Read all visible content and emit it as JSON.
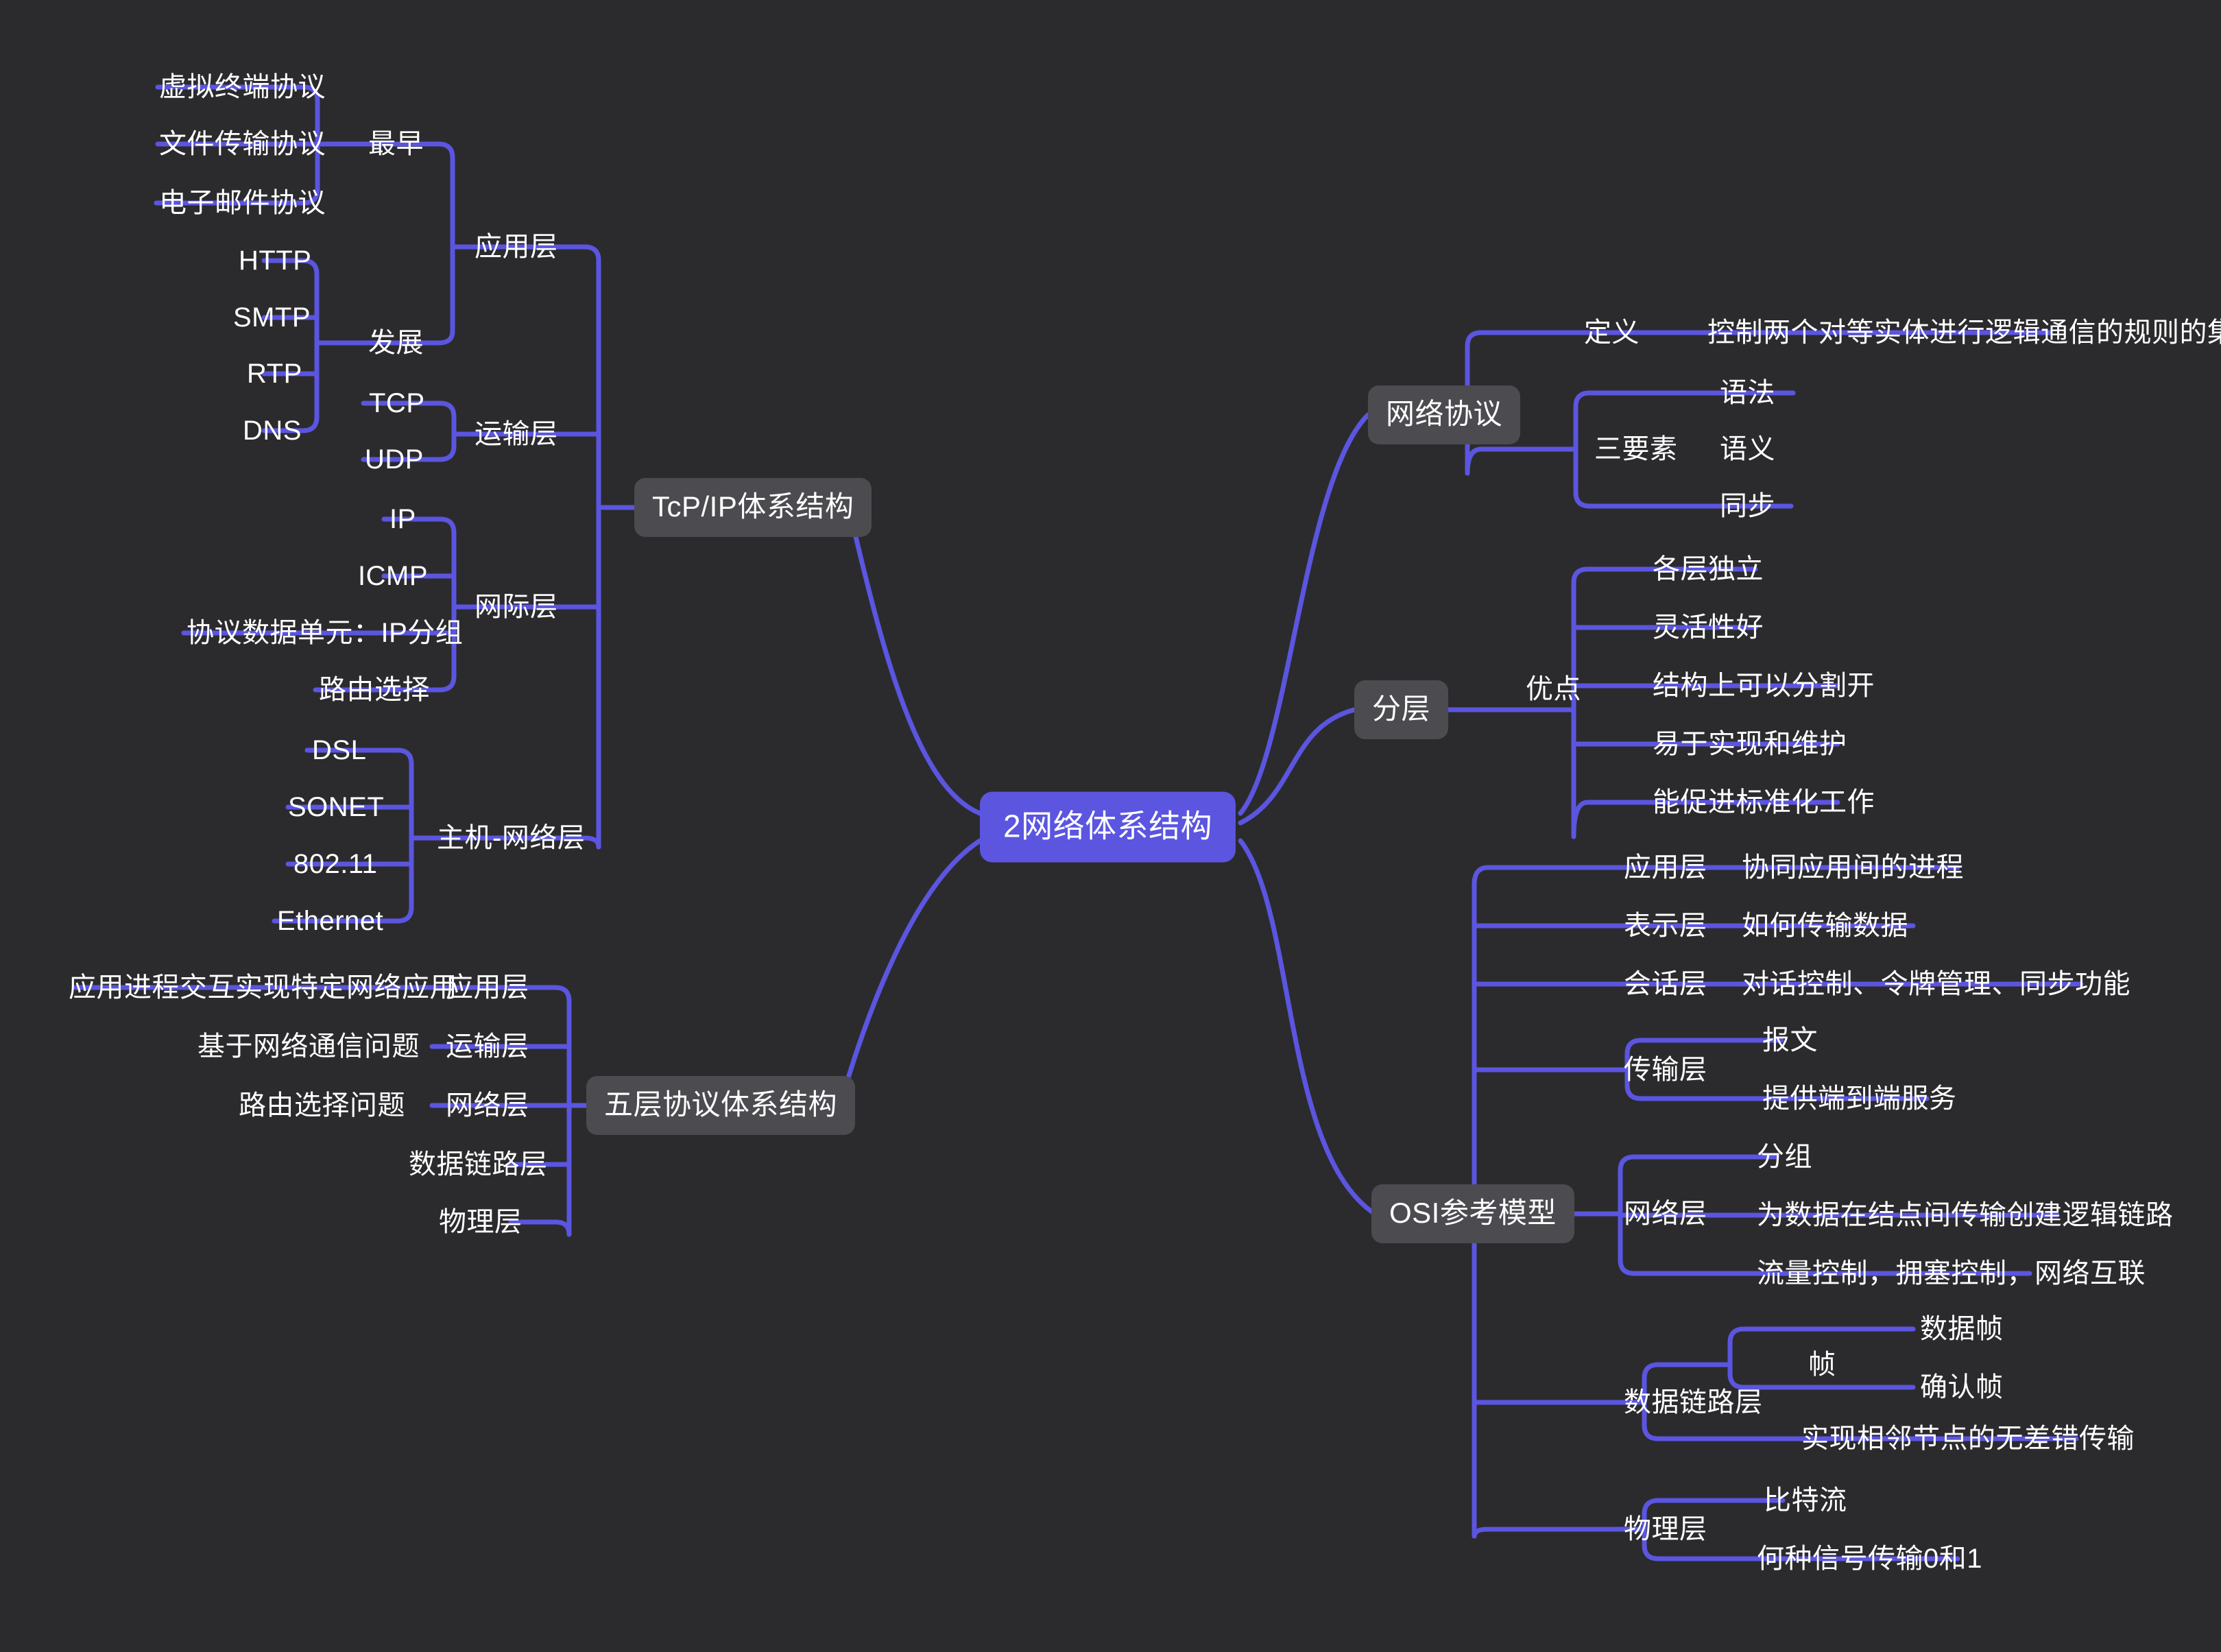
{
  "colors": {
    "background": "#2b2b2d",
    "edge": "#5b55e0",
    "root_fill": "#5b55e0",
    "topic_fill": "#4b4b50",
    "text": "#ffffff"
  },
  "root": {
    "label": "2网络体系结构"
  },
  "branches": {
    "tcpip": {
      "label": "TcP/IP体系结构",
      "children": [
        {
          "label": "应用层",
          "children": [
            {
              "label": "最早",
              "children": [
                {
                  "label": "虚拟终端协议"
                },
                {
                  "label": "文件传输协议"
                },
                {
                  "label": "电子邮件协议"
                }
              ]
            },
            {
              "label": "发展",
              "children": [
                {
                  "label": "HTTP"
                },
                {
                  "label": "SMTP"
                },
                {
                  "label": "RTP"
                },
                {
                  "label": "DNS"
                }
              ]
            }
          ]
        },
        {
          "label": "运输层",
          "children": [
            {
              "label": "TCP"
            },
            {
              "label": "UDP"
            }
          ]
        },
        {
          "label": "网际层",
          "children": [
            {
              "label": "IP"
            },
            {
              "label": "ICMP"
            },
            {
              "label": "协议数据单元：IP分组"
            },
            {
              "label": "路由选择"
            }
          ]
        },
        {
          "label": "主机-网络层",
          "children": [
            {
              "label": "DSL"
            },
            {
              "label": "SONET"
            },
            {
              "label": "802.11"
            },
            {
              "label": "Ethernet"
            }
          ]
        }
      ]
    },
    "five_layer": {
      "label": "五层协议体系结构",
      "children": [
        {
          "label": "应用层",
          "note": "应用进程交互实现特定网络应用"
        },
        {
          "label": "运输层",
          "note": "基于网络通信问题"
        },
        {
          "label": "网络层",
          "note": "路由选择问题"
        },
        {
          "label": "数据链路层",
          "note": ""
        },
        {
          "label": "物理层",
          "note": ""
        }
      ]
    },
    "protocol": {
      "label": "网络协议",
      "children": [
        {
          "label": "定义",
          "children": [
            {
              "label": "控制两个对等实体进行逻辑通信的规则的集合"
            }
          ]
        },
        {
          "label": "三要素",
          "children": [
            {
              "label": "语法"
            },
            {
              "label": "语义"
            },
            {
              "label": "同步"
            }
          ]
        }
      ]
    },
    "layering": {
      "label": "分层",
      "children": [
        {
          "label": "优点",
          "children": [
            {
              "label": "各层独立"
            },
            {
              "label": "灵活性好"
            },
            {
              "label": "结构上可以分割开"
            },
            {
              "label": "易于实现和维护"
            },
            {
              "label": "能促进标准化工作"
            }
          ]
        }
      ]
    },
    "osi": {
      "label": "OSI参考模型",
      "children": [
        {
          "label": "应用层",
          "children": [
            {
              "label": "协同应用间的进程"
            }
          ]
        },
        {
          "label": "表示层",
          "children": [
            {
              "label": "如何传输数据"
            }
          ]
        },
        {
          "label": "会话层",
          "children": [
            {
              "label": "对话控制、令牌管理、同步功能"
            }
          ]
        },
        {
          "label": "传输层",
          "children": [
            {
              "label": "报文"
            },
            {
              "label": "提供端到端服务"
            }
          ]
        },
        {
          "label": "网络层",
          "children": [
            {
              "label": "分组"
            },
            {
              "label": "为数据在结点间传输创建逻辑链路"
            },
            {
              "label": "流量控制，拥塞控制，网络互联"
            }
          ]
        },
        {
          "label": "数据链路层",
          "children": [
            {
              "label": "帧",
              "children": [
                {
                  "label": "数据帧"
                },
                {
                  "label": "确认帧"
                }
              ]
            },
            {
              "label": "实现相邻节点的无差错传输"
            }
          ]
        },
        {
          "label": "物理层",
          "children": [
            {
              "label": "比特流"
            },
            {
              "label": "何种信号传输0和1"
            }
          ]
        }
      ]
    }
  }
}
